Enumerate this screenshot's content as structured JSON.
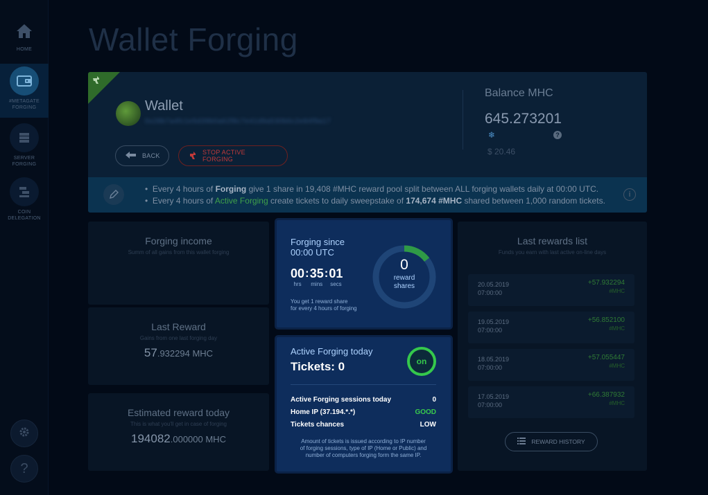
{
  "sidebar": {
    "items": [
      {
        "label": "HOME",
        "icon": "home-icon"
      },
      {
        "label": "#METAGATE FORGING",
        "icon": "wallet-icon"
      },
      {
        "label": "SERVER FORGING",
        "icon": "server-icon"
      },
      {
        "label": "COIN DELEGATION",
        "icon": "delegation-icon"
      }
    ],
    "settings_icon": "gear-icon",
    "help_glyph": "?"
  },
  "page": {
    "title": "Wallet Forging"
  },
  "wallet": {
    "name": "Wallet",
    "address": "0x28b7a4fc1e5d39b0a62f8c7e41d9a530b6c2e84f9a17",
    "back_label": "BACK",
    "stop_label": "STOP ACTIVE FORGING"
  },
  "balance": {
    "title": "Balance MHC",
    "value": "645.273201",
    "usd": "$ 20.46",
    "help_glyph": "?"
  },
  "info": {
    "line1": {
      "p1": "Every 4 hours of ",
      "b1": "Forging",
      "p2": " give 1 share in 19,408 #MHC reward pool split between ALL forging wallets daily at 00:00 UTC."
    },
    "line2": {
      "p1": "Every 4 hours of ",
      "g1": "Active Forging",
      "p2": " create tickets to daily sweepstake of ",
      "b1": "174,674 #MHC",
      "p3": " shared between 1,000 random tickets."
    },
    "info_glyph": "i"
  },
  "income": {
    "title": "Forging income",
    "subtitle": "Summ of all gains from this wallet forging"
  },
  "last_reward": {
    "title": "Last Reward",
    "subtitle": "Gains from one last forging day",
    "value_int": "57",
    "value_dec": ".932294 MHC"
  },
  "estimated": {
    "title": "Estimated reward today",
    "subtitle": "This is what you'll get in case of forging",
    "value_int": "194082",
    "value_dec": ".000000 MHC"
  },
  "forging_since": {
    "title_line1": "Forging since",
    "title_line2": "00:00 UTC",
    "hours": "00",
    "minutes": "35",
    "seconds": "01",
    "hours_label": "hrs",
    "minutes_label": "mins",
    "seconds_label": "secs",
    "separator": ":",
    "note_line1": "You get 1 reward share",
    "note_line2": "for every 4 hours of forging",
    "shares": "0",
    "shares_label_line1": "reward",
    "shares_label_line2": "shares",
    "ring_progress": 0.146,
    "ring_color": "#2f9a46"
  },
  "active_forging": {
    "title": "Active Forging today",
    "tickets": "Tickets: 0",
    "toggle": "on",
    "rows": [
      {
        "label": "Active Forging sessions today",
        "value": "0"
      },
      {
        "label": "Home IP (37.194.*.*)",
        "value": "GOOD"
      },
      {
        "label": "Tickets chances",
        "value": "LOW"
      }
    ],
    "note_line1": "Amount of tickets is issued according to IP number",
    "note_line2": "of forging sessions, type of IP (Home or Public) and",
    "note_line3": "number of computers forging form the same IP."
  },
  "rewards": {
    "title": "Last rewards list",
    "subtitle": "Funds you earn with last active on-line days",
    "items": [
      {
        "date": "20.05.2019",
        "time": "07:00:00",
        "amount": "+57.932294",
        "unit": "#MHC"
      },
      {
        "date": "19.05.2019",
        "time": "07:00:00",
        "amount": "+56.852100",
        "unit": "#MHC"
      },
      {
        "date": "18.05.2019",
        "time": "07:00:00",
        "amount": "+57.055447",
        "unit": "#MHC"
      },
      {
        "date": "17.05.2019",
        "time": "07:00:00",
        "amount": "+66.387932",
        "unit": "#MHC"
      }
    ],
    "history_label": "REWARD HISTORY"
  },
  "colors": {
    "accent_green": "#35c84c",
    "stop_red": "#c13a3a",
    "card_blue": "#0e2d5c",
    "link_blue": "#aed3ff"
  }
}
